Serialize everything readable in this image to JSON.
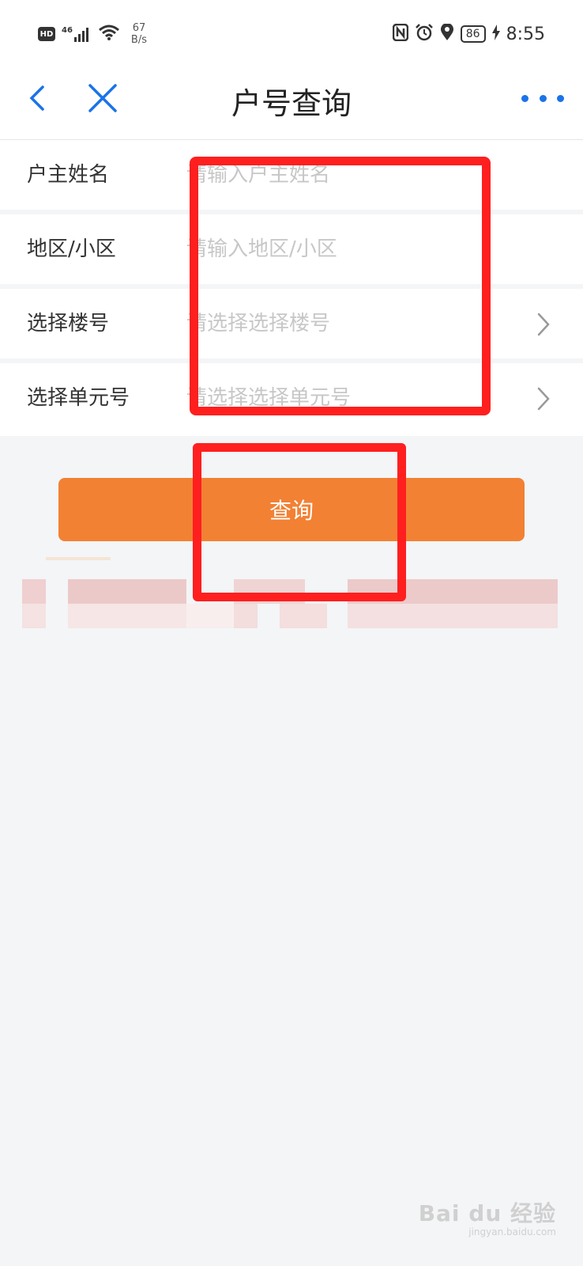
{
  "status_bar": {
    "hd": "HD",
    "network": "46",
    "speed_value": "67",
    "speed_unit": "B/s",
    "battery": "86",
    "time": "8:55"
  },
  "nav": {
    "title": "户号查询"
  },
  "form": {
    "rows": [
      {
        "label": "户主姓名",
        "placeholder": "请输入户主姓名"
      },
      {
        "label": "地区/小区",
        "placeholder": "请输入地区/小区"
      },
      {
        "label": "选择楼号",
        "placeholder": "请选择选择楼号"
      },
      {
        "label": "选择单元号",
        "placeholder": "请选择选择单元号"
      }
    ]
  },
  "query_button": "查询",
  "watermark": {
    "main": "Bai du 经验",
    "sub": "jingyan.baidu.com"
  },
  "colors": {
    "accent": "#1a73e8",
    "button": "#f28134",
    "annotation": "#ff1f1f"
  }
}
